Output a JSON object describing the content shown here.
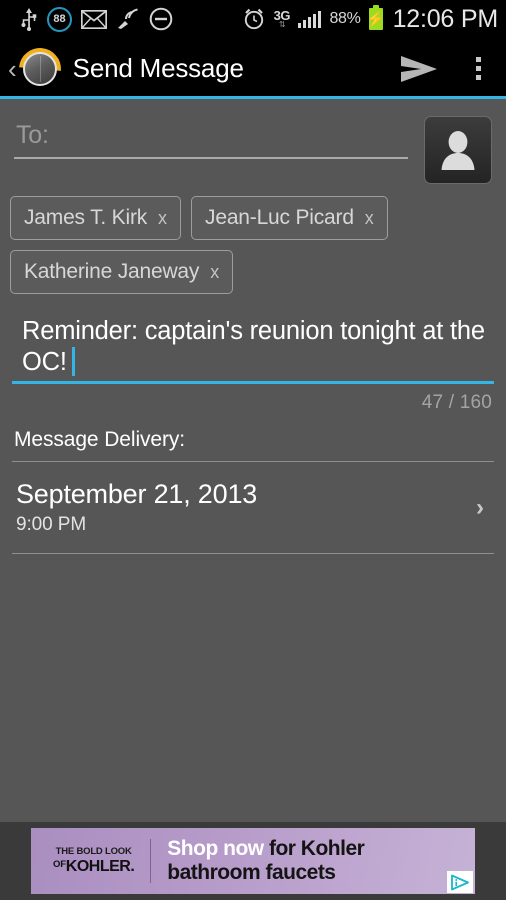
{
  "status_bar": {
    "icons_left": [
      {
        "name": "usb-icon",
        "glyph": "usb"
      },
      {
        "name": "notification-count-badge",
        "glyph": "badge",
        "value": "88"
      },
      {
        "name": "mail-icon",
        "glyph": "envelope"
      },
      {
        "name": "wifi-signal-icon",
        "glyph": "signal-waves"
      },
      {
        "name": "do-not-disturb-icon",
        "glyph": "minus-circle"
      }
    ],
    "alarm_icon": "alarm-clock-icon",
    "network_type": "3G",
    "network_arrows": "↕",
    "signal_bars": 5,
    "battery_percent": "88%",
    "battery_charging": true,
    "clock": "12:06 PM"
  },
  "action_bar": {
    "back_label": "‹",
    "app_icon": "app-logo-icon",
    "title": "Send Message",
    "send_label": "send-icon",
    "overflow_label": "overflow-menu-icon"
  },
  "compose": {
    "to_placeholder": "To:",
    "to_value": "",
    "contact_picker_icon": "person-silhouette-icon",
    "recipients": [
      {
        "name": "James T. Kirk",
        "remove": "x"
      },
      {
        "name": "Jean-Luc Picard",
        "remove": "x"
      },
      {
        "name": "Katherine Janeway",
        "remove": "x"
      }
    ],
    "message_text": "Reminder: captain's reunion tonight at the OC!",
    "char_counter": "47 / 160",
    "accent_color": "#33b5e5"
  },
  "delivery": {
    "header": "Message Delivery:",
    "date": "September 21, 2013",
    "time": "9:00 PM",
    "chevron": "›"
  },
  "ad": {
    "logo_top": "THE BOLD LOOK",
    "logo_of": "OF",
    "logo_brand": "KOHLER.",
    "headline_highlight": "Shop now",
    "headline_rest": " for Kohler",
    "subline": "bathroom faucets",
    "adchoices_label": "adchoices-icon",
    "background_color": "#b79cca"
  }
}
